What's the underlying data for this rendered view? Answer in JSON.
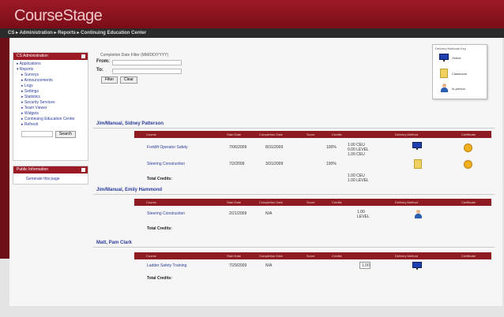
{
  "app": {
    "brand": "CourseStage",
    "breadcrumb": "CS ▸ Administration ▸ Reports ▸ Continuing Education Center"
  },
  "sidebar": {
    "header": "CS Administration",
    "items": [
      {
        "label": "▸ Applications",
        "sub": false
      },
      {
        "label": "▾ Reports",
        "sub": false
      },
      {
        "label": "▸ Surveys",
        "sub": true
      },
      {
        "label": "▸ Announcements",
        "sub": true
      },
      {
        "label": "▸ Logs",
        "sub": true
      },
      {
        "label": "▸ Settings",
        "sub": true
      },
      {
        "label": "▸ Statistics",
        "sub": true
      },
      {
        "label": "▸ Security Services",
        "sub": true
      },
      {
        "label": "▸ Team Viewer",
        "sub": true
      },
      {
        "label": "▸ Widgets",
        "sub": true
      },
      {
        "label": "▸ Continuing Education Center",
        "sub": true
      },
      {
        "label": "▸ Refresh",
        "sub": true
      }
    ],
    "search_button": "Search",
    "box2_header": "Public Information",
    "box2_link": "Generate this page"
  },
  "filter": {
    "title": "Completion Date Filter (MM/DD/YYYY)",
    "from_label": "From:",
    "to_label": "To:",
    "filter_button": "Filter",
    "clear_button": "Clear"
  },
  "legend": {
    "title": "Delivery Methods Key",
    "items": [
      {
        "label": "Online",
        "icon": "monitor-icon"
      },
      {
        "label": "Classroom",
        "icon": "book-icon"
      },
      {
        "label": "In-person",
        "icon": "person-icon"
      }
    ]
  },
  "columns": [
    "Course",
    "Start Date",
    "Completion Date",
    "Score",
    "Credits",
    "Delivery Method",
    "Certificate"
  ],
  "sections": [
    {
      "title": "Jim/Manual, Sidney Patterson",
      "rows": [
        {
          "course": "Forklift Operator Safety",
          "start": "7/06/2009",
          "completion": "8/31/2009",
          "score": "100%",
          "credits": "1.00 CEU\n0.00 LEVEL\n1.00 CEU",
          "delivery": "monitor-icon",
          "certificate": "cert-icon"
        },
        {
          "course": "Steering Construction",
          "start": "7/2/2009",
          "completion": "3/31/2009",
          "score": "100%",
          "credits": "",
          "delivery": "book-icon",
          "certificate": "cert-icon"
        }
      ],
      "total_label": "Total Credits:",
      "total_credits": "1.00 CEU\n1.00 LEVEL"
    },
    {
      "title": "Jim/Manual, Emily Hammond",
      "rows": [
        {
          "course": "Steering Construction",
          "start": "2/21/2009",
          "completion": "N/A",
          "score": "",
          "credits": "1.00\nLEVEL",
          "delivery": "person-icon",
          "certificate": ""
        }
      ],
      "total_label": "Total Credits:",
      "total_credits": ""
    },
    {
      "title": "Matt, Pam Clark",
      "rows": [
        {
          "course": "Ladder Safety Training",
          "start": "7/29/2009",
          "completion": "N/A",
          "score": "",
          "credits": "1.00",
          "delivery": "monitor-icon",
          "certificate": ""
        }
      ],
      "total_label": "Total Credits:",
      "total_credits": ""
    }
  ],
  "colors": {
    "brand": "#9b1a26",
    "table_header": "#8f1b22",
    "link": "#2b3b9a"
  }
}
